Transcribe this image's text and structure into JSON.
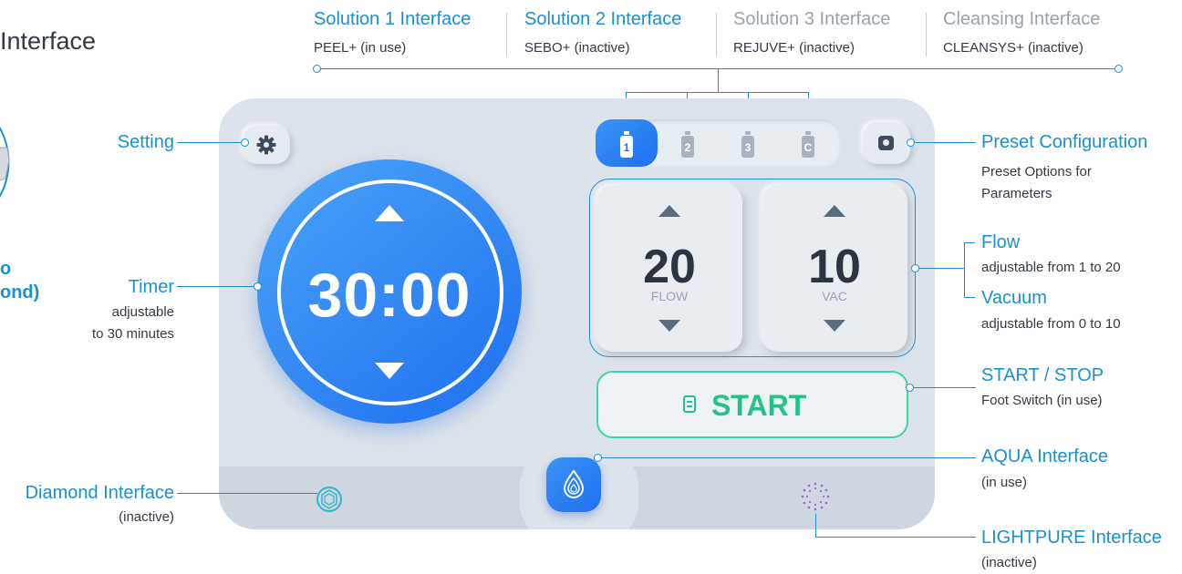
{
  "header": {
    "title_partial": "Interface"
  },
  "left_partial": {
    "line1": "o",
    "line2": "ond)"
  },
  "solutions": [
    {
      "title": "Solution 1 Interface",
      "subtitle": "PEEL+ (in use)",
      "active": true
    },
    {
      "title": "Solution 2 Interface",
      "subtitle": "SEBO+ (inactive)",
      "active": true
    },
    {
      "title": "Solution 3 Interface",
      "subtitle": "REJUVE+ (inactive)",
      "active": false
    },
    {
      "title": "Cleansing Interface",
      "subtitle": "CLEANSYS+ (inactive)",
      "active": false
    }
  ],
  "callouts": {
    "setting": {
      "title": "Setting"
    },
    "timer": {
      "title": "Timer",
      "line1": "adjustable",
      "line2": "to 30 minutes"
    },
    "diamond": {
      "title": "Diamond Interface",
      "sub": "(inactive)"
    },
    "preset": {
      "title": "Preset Configuration",
      "line1": "Preset Options for",
      "line2": "Parameters"
    },
    "flow": {
      "title": "Flow",
      "sub": "adjustable from 1 to 20"
    },
    "vacuum": {
      "title": "Vacuum",
      "sub": "adjustable from 0 to 10"
    },
    "start_stop": {
      "title": "START / STOP",
      "sub": "Foot Switch (in use)"
    },
    "aqua": {
      "title": "AQUA Interface",
      "sub": "(in use)"
    },
    "lightpure": {
      "title": "LIGHTPURE Interface",
      "sub": "(inactive)"
    }
  },
  "device": {
    "timer_value": "30:00",
    "solution_tabs": [
      "1",
      "2",
      "3",
      "C"
    ],
    "active_solution_tab": "1",
    "flow": {
      "value": "20",
      "label": "FLOW"
    },
    "vac": {
      "value": "10",
      "label": "VAC"
    },
    "start_label": "START"
  },
  "colors": {
    "accent": "#1a8fd1",
    "primary_button": "#1f6ff0",
    "start_green": "#22c28b",
    "panel": "#dde3ea"
  },
  "icons": [
    "gear-icon",
    "camera-icon",
    "bottle-icon",
    "arrow-up-icon",
    "arrow-down-icon",
    "document-icon",
    "droplet-icon",
    "diamond-icon",
    "light-dots-icon"
  ]
}
